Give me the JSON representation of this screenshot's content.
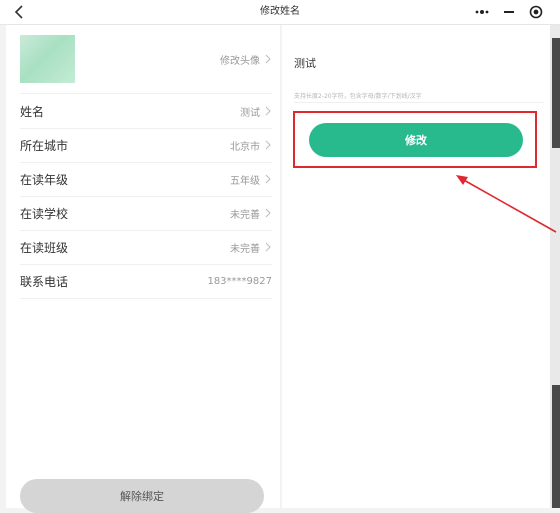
{
  "header": {
    "title": "修改姓名",
    "back_icon": "chevron-left-icon",
    "more_icon": "more-dots-icon",
    "minimize_icon": "minus-icon",
    "close_icon": "record-target-icon"
  },
  "profile": {
    "avatar_label": "修改头像",
    "rows": [
      {
        "label": "姓名",
        "value": "测试",
        "chevron": true
      },
      {
        "label": "所在城市",
        "value": "北京市",
        "chevron": true
      },
      {
        "label": "在读年级",
        "value": "五年级",
        "chevron": true
      },
      {
        "label": "在读学校",
        "value": "未完善",
        "chevron": true
      },
      {
        "label": "在读班级",
        "value": "未完善",
        "chevron": true
      },
      {
        "label": "联系电话",
        "value": "183****9827",
        "chevron": false
      }
    ],
    "unbind_label": "解除绑定"
  },
  "edit": {
    "name_value": "测试",
    "hint": "支持长度2-20字符，包含字母/数字/下划线/汉字",
    "submit_label": "修改"
  },
  "colors": {
    "accent": "#28b98d",
    "highlight": "#e0282e",
    "button_disabled": "#d5d5d5"
  }
}
